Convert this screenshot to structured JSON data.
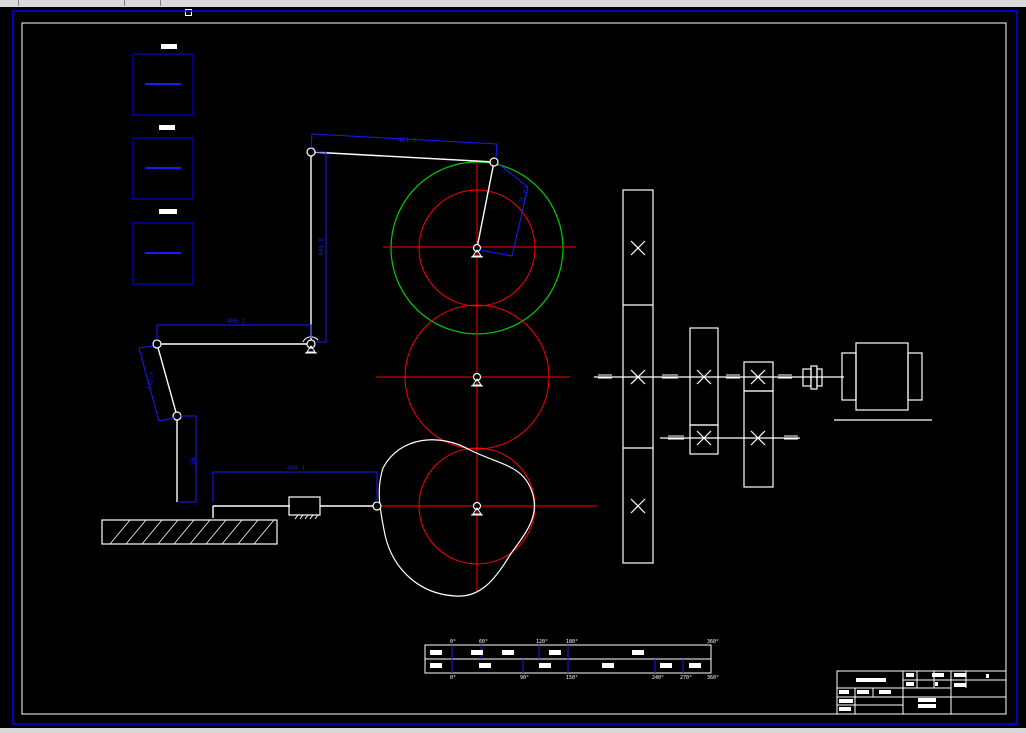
{
  "drawing": {
    "background": "#000000",
    "colors": {
      "frame_blue": "#0000ff",
      "linework": "#ffffff",
      "centerline_red": "#ff0000",
      "gear_green": "#00cc00",
      "dimension_blue": "#1a1aff"
    },
    "dimensions": {
      "crank_to_rocker": "461.8",
      "rocker_short": "75.03",
      "rocker_vertical": "449.8",
      "horizontal_link": "400.1",
      "slant_link": "115.7",
      "lower_vertical": "56",
      "slider_link": "490.1"
    },
    "title_block": {
      "name_field": "",
      "fields": [
        "",
        "",
        "",
        ""
      ]
    }
  },
  "motion_chart": {
    "top_ticks": [
      "0°",
      "60°",
      "120°",
      "180°",
      "360°"
    ],
    "bottom_ticks": [
      "0°",
      "90°",
      "150°",
      "240°",
      "270°",
      "360°"
    ],
    "rows": 2
  },
  "icons": {
    "bearing": "bearing-icon",
    "pivot": "pivot-icon",
    "coupling": "coupling-icon",
    "motor": "motor-icon"
  }
}
